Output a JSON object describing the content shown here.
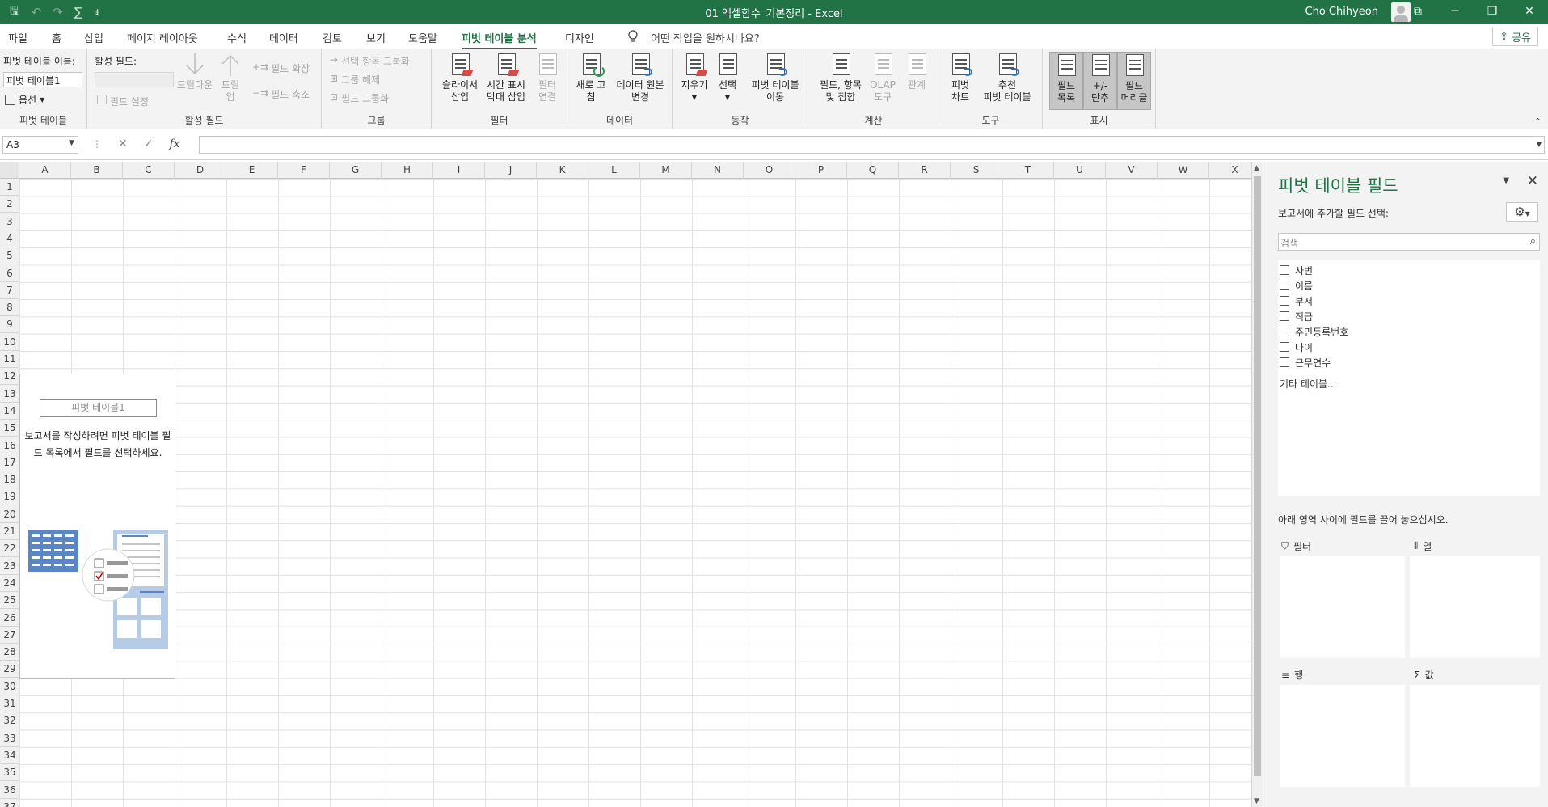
{
  "titlebar": {
    "title": "01 액셀함수_기본정리  -  Excel",
    "user": "Cho Chihyeon",
    "qat": {
      "save": "🖫",
      "undo": "↶",
      "redo": "↷",
      "autosum": "∑",
      "customize": "⇟"
    },
    "window": {
      "ribbon_opts": "⧉",
      "minimize": "─",
      "restore": "❐",
      "close": "✕"
    }
  },
  "tabs": [
    "파일",
    "홈",
    "삽입",
    "페이지 레이아웃",
    "수식",
    "데이터",
    "검토",
    "보기",
    "도움말",
    "피벗 테이블 분석",
    "디자인"
  ],
  "active_tab": "피벗 테이블 분석",
  "tell_me": "어떤 작업을 원하시나요?",
  "share": "공유",
  "ribbon": {
    "pivot_table": {
      "name_label": "피벗 테이블 이름:",
      "name_value": "피벗 테이블1",
      "options": "옵션",
      "group_label": "피벗 테이블"
    },
    "active_field": {
      "label": "활성 필드:",
      "field_settings": "필드 설정",
      "drill_down": "드릴다운",
      "drill_up_1": "드릴",
      "drill_up_2": "업",
      "expand": "필드 확장",
      "collapse": "필드 축소",
      "group_label": "활성 필드"
    },
    "group": {
      "group_selection": "선택 항목 그룹화",
      "ungroup": "그룹 해제",
      "group_field": "필드 그룹화",
      "group_label": "그룹"
    },
    "filter": {
      "slicer_1": "슬라이서",
      "slicer_2": "삽입",
      "timeline_1": "시간 표시",
      "timeline_2": "막대 삽입",
      "connections_1": "필터",
      "connections_2": "연결",
      "group_label": "필터"
    },
    "data": {
      "refresh_1": "새로 고",
      "refresh_2": "침",
      "change_source_1": "데이터 원본",
      "change_source_2": "변경",
      "group_label": "데이터"
    },
    "actions": {
      "clear": "지우기",
      "select": "선택",
      "move_1": "피벗 테이블",
      "move_2": "이동",
      "group_label": "동작"
    },
    "calculations": {
      "fields_items_1": "필드, 항목",
      "fields_items_2": "및 집합",
      "olap_1": "OLAP",
      "olap_2": "도구",
      "relationships": "관계",
      "group_label": "계산"
    },
    "tools": {
      "pivotchart_1": "피벗",
      "pivotchart_2": "차트",
      "recommended_1": "추천",
      "recommended_2": "피벗 테이블",
      "group_label": "도구"
    },
    "show": {
      "field_list_1": "필드",
      "field_list_2": "목록",
      "buttons_1": "+/-",
      "buttons_2": "단추",
      "headers_1": "필드",
      "headers_2": "머리글",
      "group_label": "표시"
    }
  },
  "formula_bar": {
    "name_box": "A3",
    "cancel": "✕",
    "enter": "✓",
    "fx": "fx",
    "value": ""
  },
  "columns": [
    "A",
    "B",
    "C",
    "D",
    "E",
    "F",
    "G",
    "H",
    "I",
    "J",
    "K",
    "L",
    "M",
    "N",
    "O",
    "P",
    "Q",
    "R",
    "S",
    "T",
    "U",
    "V",
    "W",
    "X"
  ],
  "rows": [
    "1",
    "2",
    "3",
    "4",
    "5",
    "6",
    "7",
    "8",
    "9",
    "10",
    "11",
    "12",
    "13",
    "14",
    "15",
    "16",
    "17",
    "18",
    "19",
    "20",
    "21",
    "22",
    "23",
    "24",
    "25",
    "26",
    "27",
    "28",
    "29",
    "30",
    "31",
    "32",
    "33",
    "34",
    "35",
    "36",
    "37"
  ],
  "pivot_placeholder": {
    "name": "피벗 테이블1",
    "message": "보고서를 작성하려면 피벗 테이블 필드 목록에서 필드를 선택하세요."
  },
  "field_pane": {
    "title": "피벗 테이블 필드",
    "choose_label": "보고서에 추가할 필드 선택:",
    "search_placeholder": "검색",
    "fields": [
      "사번",
      "이름",
      "부서",
      "직급",
      "주민등록번호",
      "나이",
      "근무연수"
    ],
    "more_tables": "기타 테이블...",
    "drag_msg": "아래 영역 사이에 필드를 끌어 놓으십시오.",
    "zones": {
      "filters": "필터",
      "columns": "열",
      "rows": "행",
      "values": "값"
    }
  }
}
